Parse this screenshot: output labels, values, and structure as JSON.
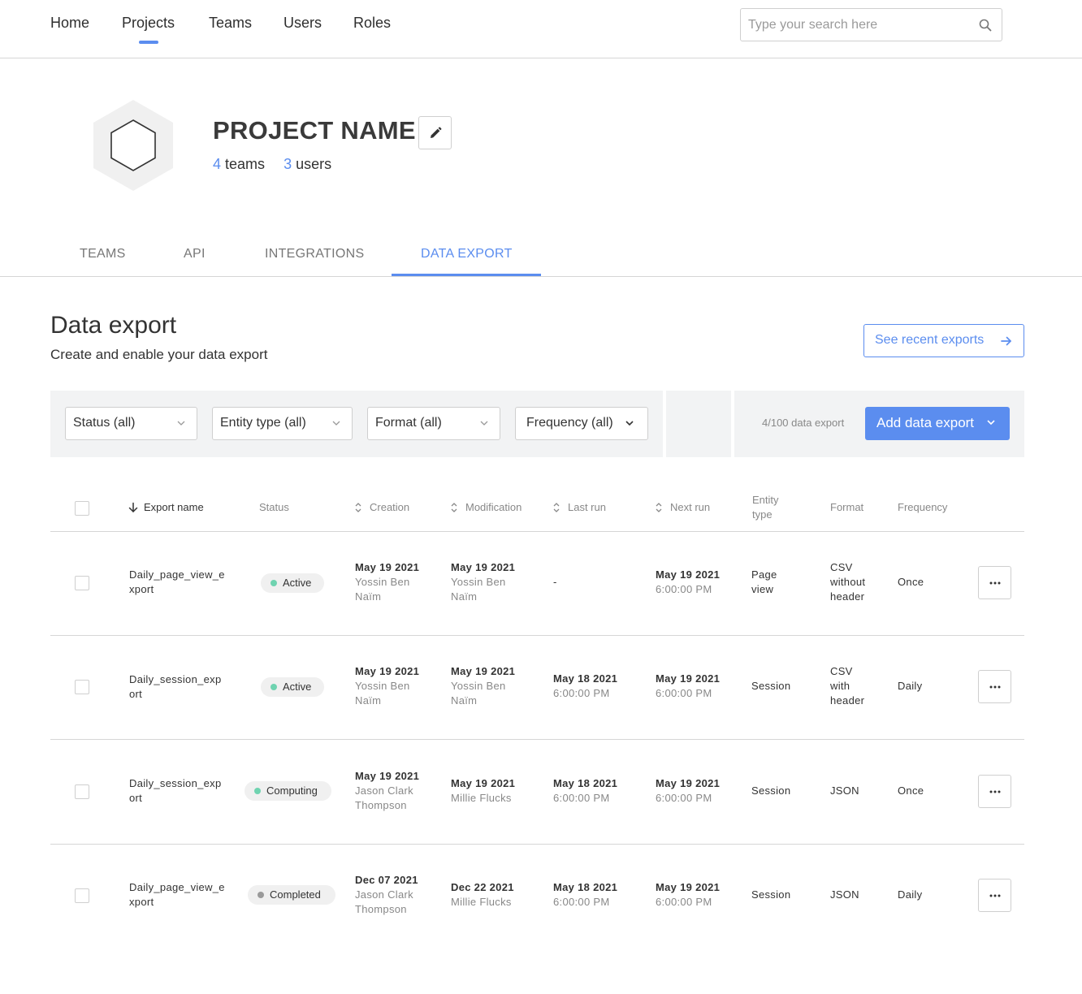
{
  "nav": {
    "items": [
      {
        "label": "Home"
      },
      {
        "label": "Projects"
      },
      {
        "label": "Teams"
      },
      {
        "label": "Users"
      },
      {
        "label": "Roles"
      }
    ],
    "active": "Projects",
    "search_placeholder": "Type your search here",
    "search_icon": "search-icon"
  },
  "project": {
    "name": "PROJECT NAME",
    "teams_count": "4",
    "teams_label": "teams",
    "users_count": "3",
    "users_label": "users",
    "edit_icon": "pencil-icon",
    "logo_icon": "hexagon-icon"
  },
  "tabs": [
    {
      "label": "TEAMS"
    },
    {
      "label": "API"
    },
    {
      "label": "INTEGRATIONS"
    },
    {
      "label": "DATA EXPORT"
    }
  ],
  "active_tab": "DATA EXPORT",
  "section": {
    "title": "Data export",
    "subtitle": "Create and enable your data export",
    "recent_button": "See recent exports"
  },
  "filters": {
    "status": "Status (all)",
    "entity_type": "Entity type (all)",
    "format": "Format (all)",
    "frequency": "Frequency (all)",
    "count": "4/100 data export",
    "add_button": "Add data export"
  },
  "table": {
    "headers": {
      "export_name": "Export name",
      "status": "Status",
      "creation": "Creation",
      "modification": "Modification",
      "last_run": "Last run",
      "next_run": "Next run",
      "entity_type_1": "Entity",
      "entity_type_2": "type",
      "format": "Format",
      "frequency": "Frequency"
    },
    "rows": [
      {
        "name_1": "Daily_page_view_e",
        "name_2": "xport",
        "status": "Active",
        "creation_date": "May 19 2021",
        "creation_by_1": "Yossin Ben",
        "creation_by_2": "Naïm",
        "mod_date": "May 19 2021",
        "mod_by_1": "Yossin Ben",
        "mod_by_2": "Naïm",
        "last_run": "-",
        "next_run_date": "May 19 2021",
        "next_run_time": "6:00:00 PM",
        "entity_1": "Page",
        "entity_2": "view",
        "format_1": "CSV",
        "format_2": "without",
        "format_3": "header",
        "frequency": "Once"
      },
      {
        "name_1": "Daily_session_exp",
        "name_2": "ort",
        "status": "Active",
        "creation_date": "May 19 2021",
        "creation_by_1": "Yossin Ben",
        "creation_by_2": "Naïm",
        "mod_date": "May 19 2021",
        "mod_by_1": "Yossin Ben",
        "mod_by_2": "Naïm",
        "last_run_date": "May 18 2021",
        "last_run_time": "6:00:00 PM",
        "next_run_date": "May 19 2021",
        "next_run_time": "6:00:00 PM",
        "entity": "Session",
        "format_1": "CSV",
        "format_2": "with",
        "format_3": "header",
        "frequency": "Daily"
      },
      {
        "name_1": "Daily_session_exp",
        "name_2": "ort",
        "status": "Computing",
        "creation_date": "May 19 2021",
        "creation_by_1": "Jason Clark",
        "creation_by_2": "Thompson",
        "mod_date": "May 19 2021",
        "mod_by": "Millie Flucks",
        "last_run_date": "May 18 2021",
        "last_run_time": "6:00:00 PM",
        "next_run_date": "May 19 2021",
        "next_run_time": "6:00:00 PM",
        "entity": "Session",
        "format": "JSON",
        "frequency": "Once"
      },
      {
        "name_1": "Daily_page_view_e",
        "name_2": "xport",
        "status": "Completed",
        "creation_date": "Dec 07 2021",
        "creation_by_1": "Jason Clark",
        "creation_by_2": "Thompson",
        "mod_date": "Dec 22 2021",
        "mod_by": "Millie Flucks",
        "last_run_date": "May 18 2021",
        "last_run_time": "6:00:00 PM",
        "next_run_date": "May 19 2021",
        "next_run_time": "6:00:00 PM",
        "entity": "Session",
        "format": "JSON",
        "frequency": "Daily"
      }
    ]
  },
  "colors": {
    "accent": "#5b8def",
    "active_dot": "#6fd3b0",
    "completed_dot": "#9a9a9a"
  }
}
